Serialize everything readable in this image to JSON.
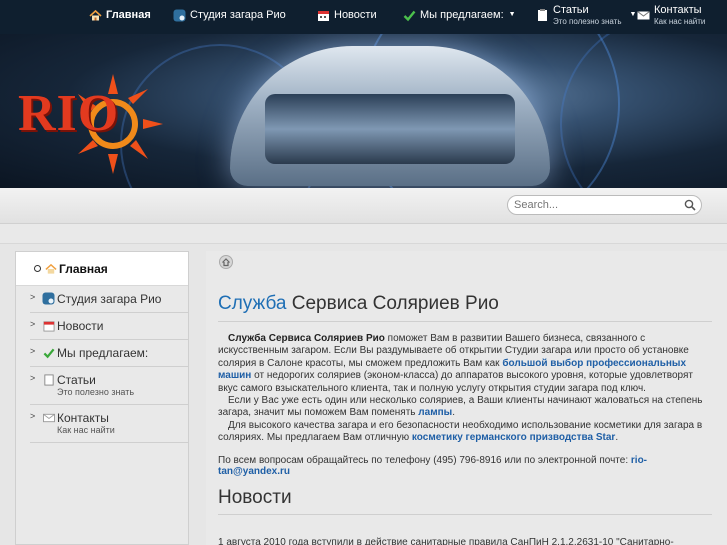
{
  "nav": {
    "items": [
      {
        "label": "Главная",
        "icon": "home-icon"
      },
      {
        "label": "Студия загара Рио",
        "icon": "studio-icon"
      },
      {
        "label": "Новости",
        "icon": "calendar-icon"
      },
      {
        "label": "Мы предлагаем:",
        "icon": "checkmark-icon"
      },
      {
        "label": "Статьи",
        "sub": "Это полезно знать",
        "icon": "document-icon"
      },
      {
        "label": "Контакты",
        "sub": "Как нас найти",
        "icon": "mail-icon"
      }
    ]
  },
  "banner": {
    "logo_text": "RIO"
  },
  "search": {
    "placeholder": "Search..."
  },
  "sidebar": {
    "items": [
      {
        "label": "Главная"
      },
      {
        "label": "Студия загара Рио"
      },
      {
        "label": "Новости"
      },
      {
        "label": "Мы предлагаем:"
      },
      {
        "label": "Статьи",
        "sub": "Это полезно знать"
      },
      {
        "label": "Контакты",
        "sub": "Как нас найти"
      }
    ]
  },
  "main": {
    "title_highlight": "Служба",
    "title_rest": " Сервиса Соляриев Рио",
    "p1_bold": "Служба Сервиса Соляриев Рио",
    "p1_a": " поможет Вам в развитии Вашего бизнеса, связанного с искусственным загаром. Если Вы раздумываете об открытии Студии загара или просто об установке солярия в Салоне красоты, мы сможем предложить Вам как ",
    "p1_link": "большой выбор профессиональных машин",
    "p1_b": " от недорогих соляриев (эконом-класса) до аппаратов высокого уровня, которые удовлетворят вкус самого взыскательного клиента, так и полную услугу открытия студии загара под ключ.",
    "p2_a": "Если у Вас уже есть один или несколько соляриев, а Ваши клиенты начинают жаловаться на степень загара, значит мы поможем Вам поменять ",
    "p2_link": "лампы",
    "p2_b": ".",
    "p3_a": "Для высокого качества загара и его безопасности необходимо использование косметики для загара в соляриях. Мы предлагаем Вам отличную ",
    "p3_link": "косметику германского призводства Star",
    "p3_b": ".",
    "contact_text": "По всем вопросам обращайтесь по телефону (495) 796-8916 или по электронной почте: ",
    "contact_email": "rio-tan@yandex.ru",
    "news_title": "Новости",
    "news_text": "1 августа 2010 года вступили в действие санитарные правила СанПиН 2.1.2.2631-10 \"Санитарно-"
  }
}
